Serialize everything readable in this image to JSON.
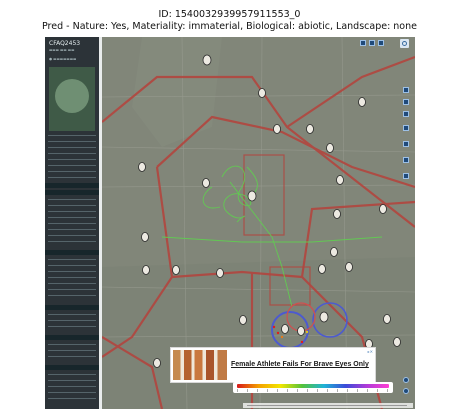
{
  "caption": {
    "id_line": "ID: 1540032939957911553_0",
    "pred_line": "Pred - Nature: Yes, Materiality: immaterial, Biological: abiotic, Landscape: none"
  },
  "flight_panel": {
    "callsign": "CFAQ2453"
  },
  "ad": {
    "headline": "Female Athlete Fails For Brave Eyes Only"
  },
  "colors": {
    "panel_bg": "#2c3338",
    "map_bg": "#818679",
    "airspace_red": "#b2463f",
    "track_green": "#5fd04f",
    "track_blue": "#4c5ad0"
  },
  "icons": [
    "aircraft-icon",
    "layers-icon",
    "settings-icon",
    "zoom-in-icon",
    "zoom-out-icon"
  ]
}
